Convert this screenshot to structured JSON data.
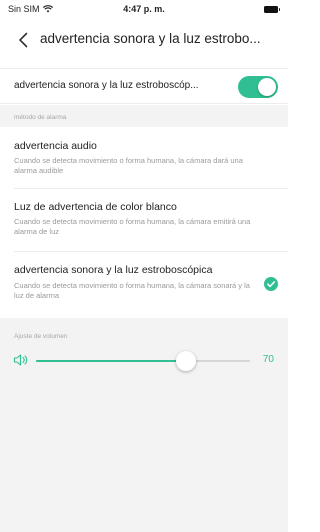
{
  "status_bar": {
    "carrier": "Sin SIM",
    "time": "4:47 p. m."
  },
  "nav": {
    "title": "advertencia sonora y la luz estrobo..."
  },
  "master": {
    "label": "advertencia sonora y la luz estroboscóp...",
    "enabled": true
  },
  "alarm_section": {
    "header": "método de alarma"
  },
  "options": [
    {
      "title": "advertencia audio",
      "desc": "Cuando se detecta movimiento o forma humana, la cámara dará una alarma audible",
      "selected": false
    },
    {
      "title": "Luz de advertencia de color blanco",
      "desc": "Cuando se detecta movimiento o forma humana, la cámara emitirá una alarma de luz",
      "selected": false
    },
    {
      "title": "advertencia sonora y la luz estroboscópica",
      "desc": "Cuando se detecta movimiento o forma humana, la cámara sonará y la luz de alarma",
      "selected": true
    }
  ],
  "volume": {
    "label": "Ajuste de volumen",
    "value": "70",
    "level": 0.7
  },
  "colors": {
    "accent": "#2fbf92",
    "section_bg": "#f3f3f3",
    "muted_text": "#9a9a9a"
  },
  "icons": {
    "back": "chevron-left-icon",
    "wifi": "wifi-icon",
    "battery": "battery-icon",
    "speaker": "speaker-icon",
    "check": "check-circle-icon"
  }
}
